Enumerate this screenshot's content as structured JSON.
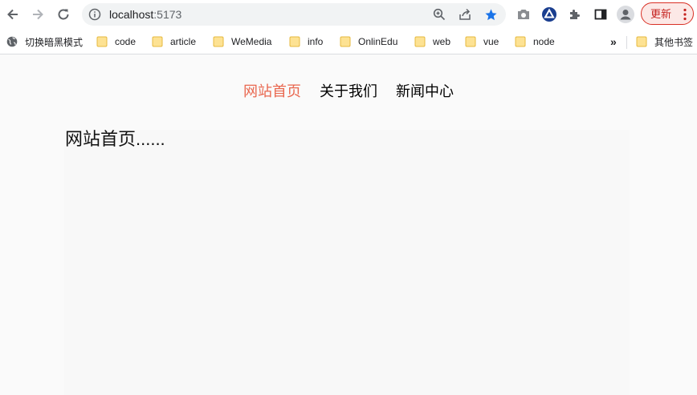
{
  "browser": {
    "url_host": "localhost",
    "url_port": ":5173",
    "update_label": "更新",
    "colors": {
      "star": "#1a73e8",
      "update_border": "#d93025",
      "active_nav": "#e9674f"
    }
  },
  "bookmarks": {
    "items": [
      {
        "label": "切换暗黑模式",
        "icon": "globe-icon"
      },
      {
        "label": "code",
        "icon": "folder-icon"
      },
      {
        "label": "article",
        "icon": "folder-icon"
      },
      {
        "label": "WeMedia",
        "icon": "folder-icon"
      },
      {
        "label": "info",
        "icon": "folder-icon"
      },
      {
        "label": "OnlinEdu",
        "icon": "folder-icon"
      },
      {
        "label": "web",
        "icon": "folder-icon"
      },
      {
        "label": "vue",
        "icon": "folder-icon"
      },
      {
        "label": "node",
        "icon": "folder-icon"
      }
    ],
    "overflow_label": "»",
    "other_label": "其他书签"
  },
  "page": {
    "nav": [
      {
        "label": "网站首页",
        "active": true
      },
      {
        "label": "关于我们",
        "active": false
      },
      {
        "label": "新闻中心",
        "active": false
      }
    ],
    "content": "网站首页......"
  }
}
